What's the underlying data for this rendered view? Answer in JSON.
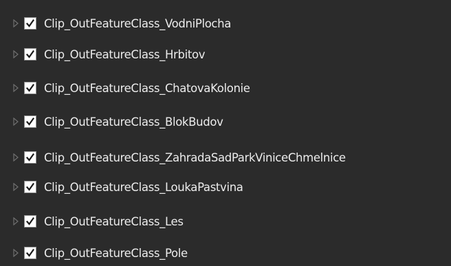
{
  "layers": [
    {
      "label": "Clip_OutFeatureClass_VodniPlocha",
      "checked": true,
      "expanded": false
    },
    {
      "label": "Clip_OutFeatureClass_Hrbitov",
      "checked": true,
      "expanded": false
    },
    {
      "label": "Clip_OutFeatureClass_ChatovaKolonie",
      "checked": true,
      "expanded": false
    },
    {
      "label": "Clip_OutFeatureClass_BlokBudov",
      "checked": true,
      "expanded": false
    },
    {
      "label": "Clip_OutFeatureClass_ZahradaSadParkViniceChmelnice",
      "checked": true,
      "expanded": false
    },
    {
      "label": "Clip_OutFeatureClass_LoukaPastvina",
      "checked": true,
      "expanded": false
    },
    {
      "label": "Clip_OutFeatureClass_Les",
      "checked": true,
      "expanded": false
    },
    {
      "label": "Clip_OutFeatureClass_Pole",
      "checked": true,
      "expanded": false
    }
  ],
  "icons": {
    "expander": "expand-triangle-icon",
    "check": "checkmark-icon"
  },
  "colors": {
    "background": "#2b2b2b",
    "text": "#ececec",
    "expander": "#6f6f6f",
    "checkbox_fill": "#ffffff",
    "checkmark": "#1a1a1a"
  }
}
